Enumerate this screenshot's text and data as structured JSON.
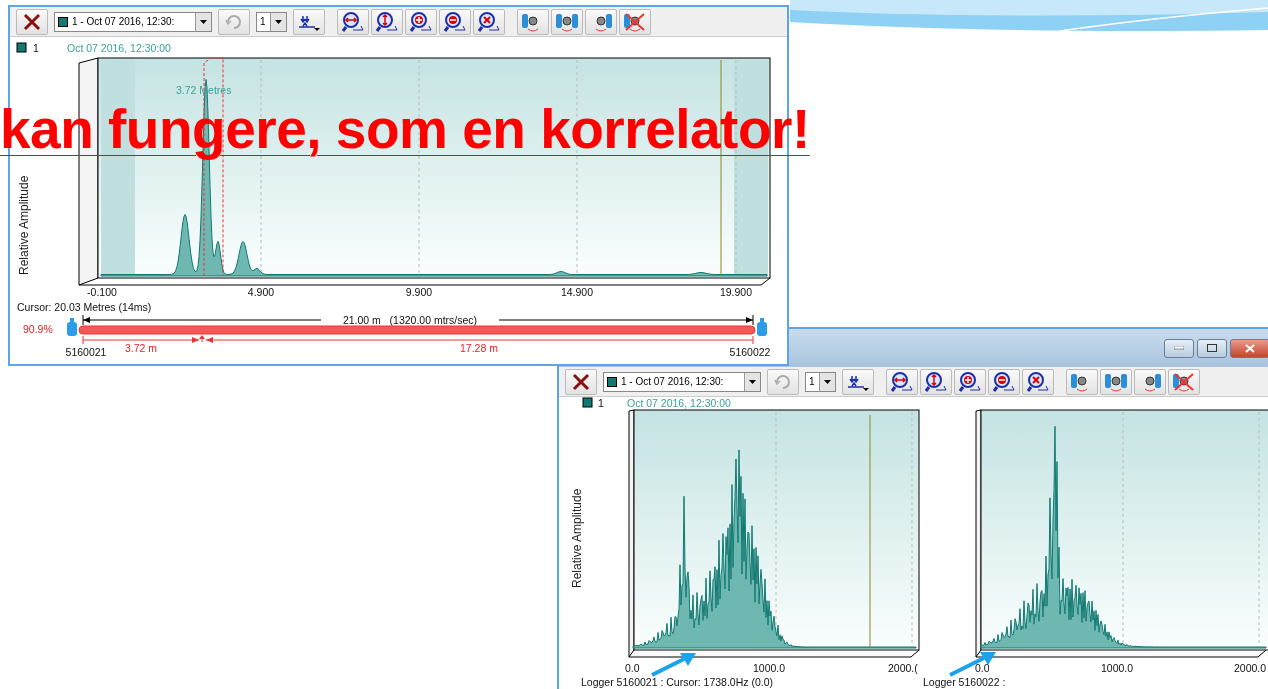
{
  "slide_title": "kan fungere, som en korrelator!",
  "correlation_window": {
    "toolbar": {
      "dataset": "1 - Oct 07 2016, 12:30:",
      "count": "1"
    },
    "legend": {
      "number": "1",
      "timestamp": "Oct 07 2016, 12:30:00"
    },
    "y_label": "Relative Amplitude",
    "peak_label": "3.72 Metres",
    "x_ticks": [
      "-0.100",
      "4.900",
      "9.900",
      "14.900",
      "19.900"
    ],
    "cursor": "Cursor: 20.03 Metres (14ms)",
    "pipe": {
      "percent": "90.9%",
      "total": "21.00 m   (1320.00 mtrs/sec)",
      "left_distance": "3.72 m",
      "right_distance": "17.28 m",
      "left_logger": "5160021",
      "right_logger": "5160022"
    }
  },
  "spectrum_window": {
    "toolbar": {
      "dataset": "1 - Oct 07 2016, 12:30:",
      "count": "1"
    },
    "legend": {
      "number": "1",
      "timestamp": "Oct 07 2016, 12:30:00"
    },
    "y_label": "Relative Amplitude",
    "plots": [
      {
        "x_ticks": [
          "0.0",
          "1000.0",
          "2000.("
        ],
        "footer": "Logger 5160021 : Cursor: 1738.0Hz (0.0)"
      },
      {
        "x_ticks": [
          "0.0",
          "1000.0",
          "2000.0"
        ],
        "footer": "Logger 5160022 :"
      }
    ]
  }
}
